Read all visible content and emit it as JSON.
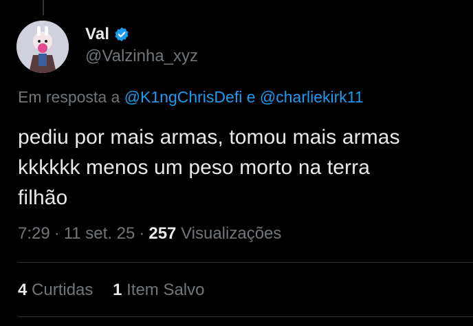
{
  "author": {
    "display_name": "Val",
    "handle": "@Valzinha_xyz",
    "verified_icon": "verified-badge-icon",
    "avatar_icon": "anime-character-avatar"
  },
  "reply": {
    "prefix": "Em resposta a",
    "mention_1": "@K1ngChrisDefi",
    "conjunction": "e",
    "mention_2": "@charliekirk11"
  },
  "tweet": {
    "lines": [
      "pediu por mais armas, tomou mais armas",
      "kkkkkk menos um peso morto na terra",
      "filhão"
    ]
  },
  "meta": {
    "time": "7:29",
    "date": "11 set. 25",
    "views_count": "257",
    "views_label": "Visualizações",
    "separator": "·"
  },
  "stats": {
    "likes_count": "4",
    "likes_label": "Curtidas",
    "saves_count": "1",
    "saves_label": "Item Salvo"
  },
  "colors": {
    "background": "#000000",
    "text": "#e7e9ea",
    "muted": "#71767b",
    "accent": "#1d9bf0",
    "divider": "#2f3336"
  }
}
